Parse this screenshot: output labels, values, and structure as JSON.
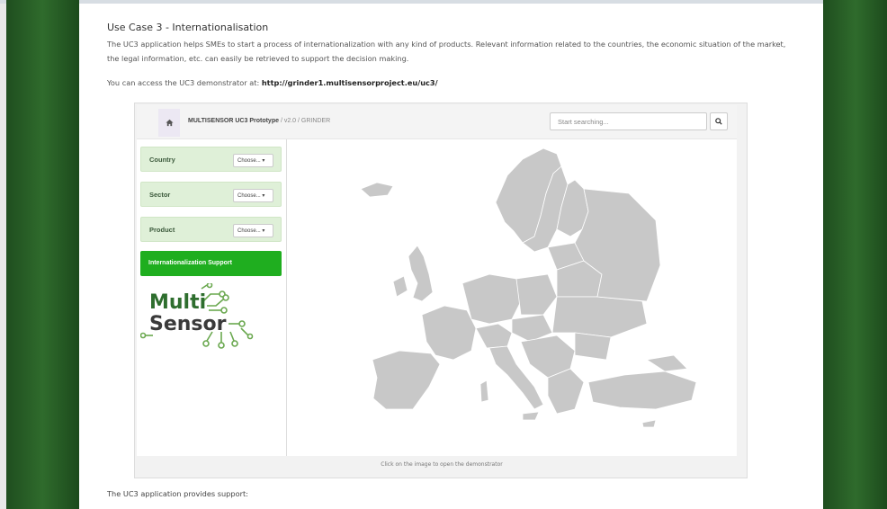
{
  "article": {
    "title": "Use Case 3 - Internationalisation",
    "description": "The UC3 application helps SMEs to start a process of internationalization with any kind of products. Relevant information related to the countries, the economic situation of the market, the legal information, etc. can easily be retrieved to support the decision making.",
    "access_text": "You can access the UC3 demonstrator at:",
    "access_link": "http://grinder1.multisensorproject.eu/uc3/",
    "caption": "Click on the image to open the demonstrator",
    "support_text": "The UC3 application provides support:"
  },
  "demo": {
    "brand_bold": "MULTISENSOR UC3 Prototype",
    "brand_rest": "/ v2.0 / GRINDER",
    "search_placeholder": "Start searching...",
    "filters": [
      {
        "label": "Country",
        "dropdown": "Choose..."
      },
      {
        "label": "Sector",
        "dropdown": "Choose..."
      },
      {
        "label": "Product",
        "dropdown": "Choose..."
      }
    ],
    "support_button": "Internationalization Support",
    "logo_line1": "Multi",
    "logo_line2": "Sensor"
  },
  "colors": {
    "side_green": "#2f6b2c",
    "filter_bg": "#dff0d8",
    "button_green": "#1fae1f",
    "map_gray": "#c8c8c8"
  }
}
